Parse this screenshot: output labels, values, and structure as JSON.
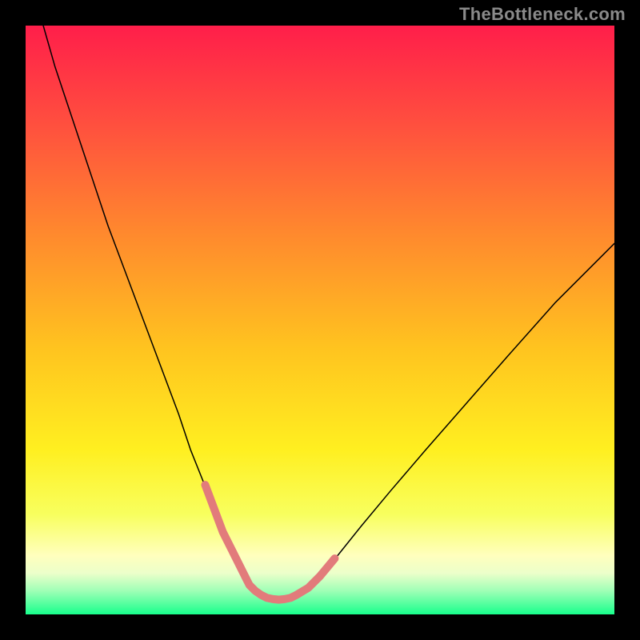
{
  "attribution": "TheBottleneck.com",
  "chart_data": {
    "type": "line",
    "title": "",
    "xlabel": "",
    "ylabel": "",
    "xlim": [
      0,
      100
    ],
    "ylim": [
      0,
      100
    ],
    "grid": false,
    "series": [
      {
        "name": "bottleneck-curve",
        "color": "#000000",
        "stroke_width": 1.5,
        "x": [
          3,
          5,
          8,
          11,
          14,
          17,
          20,
          23,
          26,
          28,
          30,
          32,
          33.5,
          35,
          36,
          37,
          37.5,
          38,
          39,
          40,
          41,
          42,
          43,
          44,
          45,
          46,
          48,
          50,
          53,
          57,
          62,
          68,
          75,
          82,
          90,
          98,
          100
        ],
        "y": [
          100,
          93,
          84,
          75,
          66,
          58,
          50,
          42,
          34,
          28,
          23,
          18,
          14,
          11,
          9,
          7,
          6,
          5,
          4,
          3.3,
          2.8,
          2.6,
          2.5,
          2.6,
          2.8,
          3.3,
          4.5,
          6.5,
          10,
          15,
          21,
          28,
          36,
          44,
          53,
          61,
          63
        ]
      },
      {
        "name": "sweet-spot-overlay",
        "color": "#e27b7b",
        "stroke_width": 10,
        "x": [
          30.5,
          32,
          33.5,
          35,
          36,
          37,
          37.5,
          38,
          39,
          40,
          41,
          42,
          43,
          44,
          45,
          46,
          48,
          50,
          52.5
        ],
        "y": [
          22,
          18,
          14,
          11,
          9,
          7,
          6,
          5,
          4,
          3.3,
          2.8,
          2.6,
          2.5,
          2.6,
          2.8,
          3.3,
          4.5,
          6.5,
          9.5
        ]
      }
    ],
    "gradient_stops": [
      {
        "pct": 0,
        "color": "#ff1e4a"
      },
      {
        "pct": 16,
        "color": "#ff4d3f"
      },
      {
        "pct": 36,
        "color": "#ff8b2d"
      },
      {
        "pct": 55,
        "color": "#ffc41f"
      },
      {
        "pct": 72,
        "color": "#ffef20"
      },
      {
        "pct": 83,
        "color": "#f8ff5e"
      },
      {
        "pct": 90,
        "color": "#ffffbd"
      },
      {
        "pct": 93,
        "color": "#ecffca"
      },
      {
        "pct": 96,
        "color": "#9fffb6"
      },
      {
        "pct": 100,
        "color": "#18ff8c"
      }
    ]
  }
}
